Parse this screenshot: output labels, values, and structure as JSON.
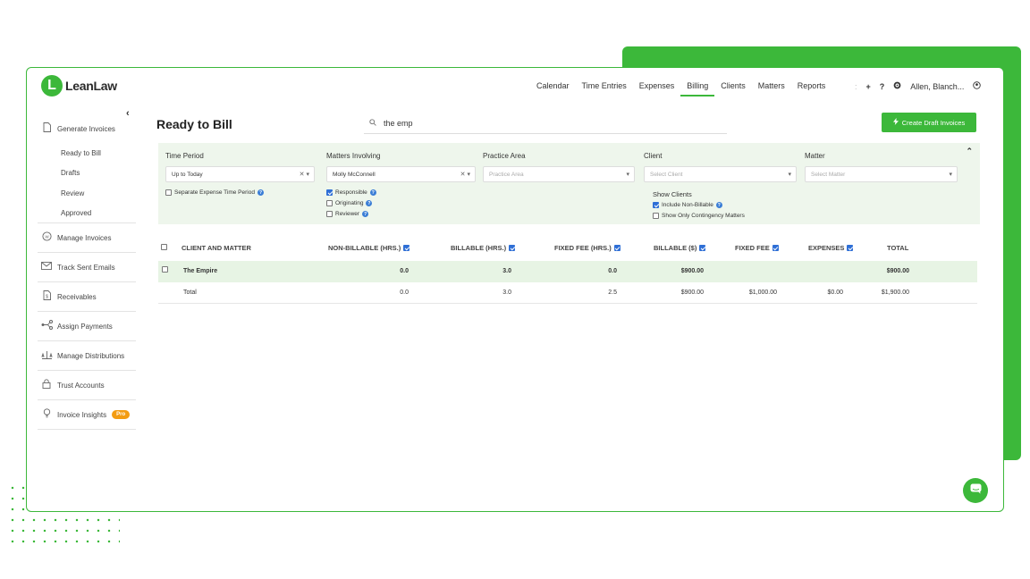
{
  "brand": {
    "logo_letter": "L",
    "name": "LeanLaw",
    "accent": "#3cb83a"
  },
  "topnav": [
    {
      "label": "Calendar",
      "active": false
    },
    {
      "label": "Time Entries",
      "active": false
    },
    {
      "label": "Expenses",
      "active": false
    },
    {
      "label": "Billing",
      "active": true
    },
    {
      "label": "Clients",
      "active": false
    },
    {
      "label": "Matters",
      "active": false
    },
    {
      "label": "Reports",
      "active": false
    }
  ],
  "topright": {
    "plus": "+",
    "help": "?",
    "user": "Allen, Blanch..."
  },
  "sidebar": {
    "generate": "Generate Invoices",
    "sub": [
      "Ready to Bill",
      "Drafts",
      "Review",
      "Approved"
    ],
    "items": [
      "Manage Invoices",
      "Track Sent Emails",
      "Receivables",
      "Assign Payments",
      "Manage Distributions",
      "Trust Accounts",
      "Invoice Insights"
    ],
    "pro_badge": "Pro"
  },
  "page": {
    "title": "Ready to Bill",
    "search_value": "the emp",
    "create_label": "Create Draft Invoices"
  },
  "filters": {
    "time_period": {
      "label": "Time Period",
      "value": "Up to Today"
    },
    "matters_involving": {
      "label": "Matters Involving",
      "value": "Molly McConnell"
    },
    "practice_area": {
      "label": "Practice Area",
      "placeholder": "Practice Area"
    },
    "client": {
      "label": "Client",
      "placeholder": "Select Client"
    },
    "matter": {
      "label": "Matter",
      "placeholder": "Select Matter"
    },
    "separate_expense": "Separate Expense Time Period",
    "responsible": "Responsible",
    "originating": "Originating",
    "reviewer": "Reviewer",
    "show_clients": "Show Clients",
    "include_nonbillable": "Include Non-Billable",
    "contingency": "Show Only Contingency Matters"
  },
  "table": {
    "headers": {
      "client": "CLIENT AND MATTER",
      "nonbillable": "NON-BILLABLE (HRS.)",
      "billable": "BILLABLE (HRS.)",
      "fixedhrs": "FIXED FEE (HRS.)",
      "billable_usd": "BILLABLE ($)",
      "fixedfee": "FIXED FEE",
      "expenses": "EXPENSES",
      "total": "TOTAL"
    },
    "row": {
      "client": "The Empire",
      "nonbillable": "0.0",
      "billable": "3.0",
      "fixedhrs": "0.0",
      "billable_usd": "$900.00",
      "fixedfee": "",
      "expenses": "",
      "total": "$900.00"
    },
    "totals": {
      "client": "Total",
      "nonbillable": "0.0",
      "billable": "3.0",
      "fixedhrs": "2.5",
      "billable_usd": "$900.00",
      "fixedfee": "$1,000.00",
      "expenses": "$0.00",
      "total": "$1,900.00"
    }
  }
}
